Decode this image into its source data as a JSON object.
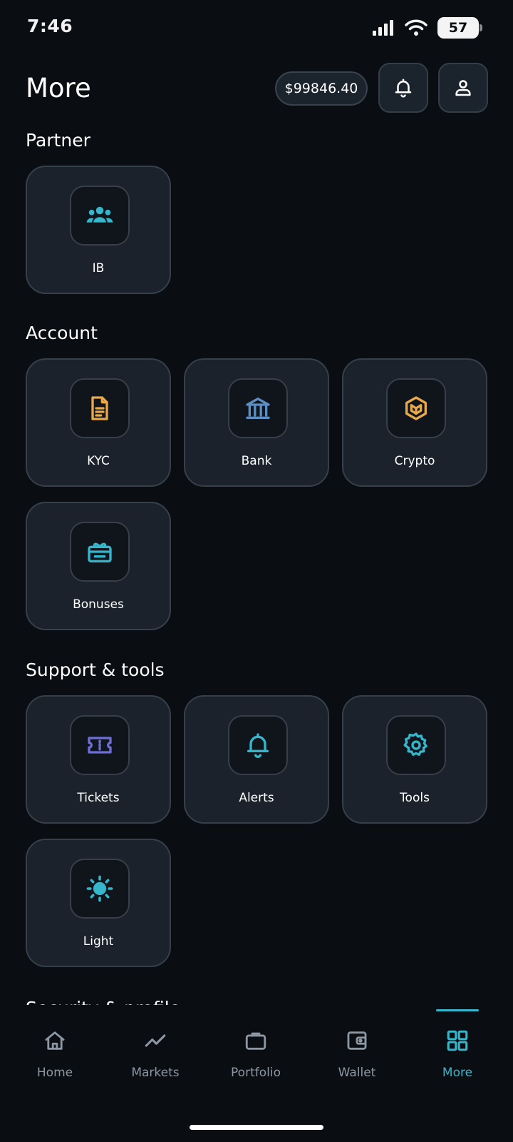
{
  "status_bar": {
    "time": "7:46",
    "battery": "57"
  },
  "header": {
    "title": "More",
    "balance": "$99846.40"
  },
  "sections": {
    "partner": {
      "title": "Partner",
      "items": {
        "ib": "IB"
      }
    },
    "account": {
      "title": "Account",
      "items": {
        "kyc": "KYC",
        "bank": "Bank",
        "crypto": "Crypto",
        "bonuses": "Bonuses"
      }
    },
    "support": {
      "title": "Support & tools",
      "items": {
        "tickets": "Tickets",
        "alerts": "Alerts",
        "tools": "Tools",
        "light": "Light"
      }
    },
    "security": {
      "title": "Security & profile"
    }
  },
  "nav": {
    "home": "Home",
    "markets": "Markets",
    "portfolio": "Portfolio",
    "wallet": "Wallet",
    "more": "More"
  },
  "icons": {
    "ib": "users-group-icon",
    "kyc": "document-icon",
    "bank": "bank-icon",
    "crypto": "crypto-cube-icon",
    "bonuses": "gift-icon",
    "tickets": "ticket-icon",
    "alerts": "bell-icon",
    "tools": "gear-icon",
    "light": "sun-icon"
  },
  "colors": {
    "background": "#0a0d11",
    "tile": "#1b222b",
    "accent": "#35b6cc",
    "gold": "#e8a94a",
    "bank_blue": "#5b8fc4",
    "ticket_purple": "#6e6fd6",
    "nav_inactive": "#8d97a3"
  }
}
